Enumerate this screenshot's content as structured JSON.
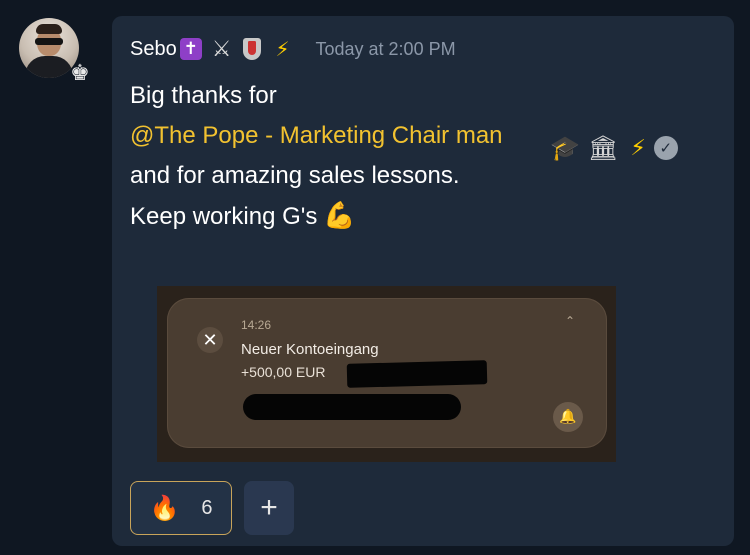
{
  "message": {
    "author": "Sebo",
    "timestamp": "Today at 2:00 PM",
    "author_badges": {
      "cross": "✝",
      "swords": "⚔",
      "bolt": "⚡"
    },
    "line1": "Big thanks for",
    "mention": "@The Pope - Marketing Chair man",
    "mention_badges": {
      "cap": "🎓",
      "bank": "🏛",
      "bolt": "⚡",
      "check": "✓"
    },
    "line2": "and for amazing sales lessons.",
    "line3": "Keep working G's",
    "flex_emoji": "💪"
  },
  "avatar_badge": "♚",
  "embed": {
    "close": "✕",
    "time": "14:26",
    "title": "Neuer Kontoeingang",
    "amount": "+500,00 EUR",
    "chevron": "⌃",
    "bell": "🔔"
  },
  "reactions": [
    {
      "emoji": "🔥",
      "count": "6"
    }
  ],
  "add_reaction_label": "+"
}
